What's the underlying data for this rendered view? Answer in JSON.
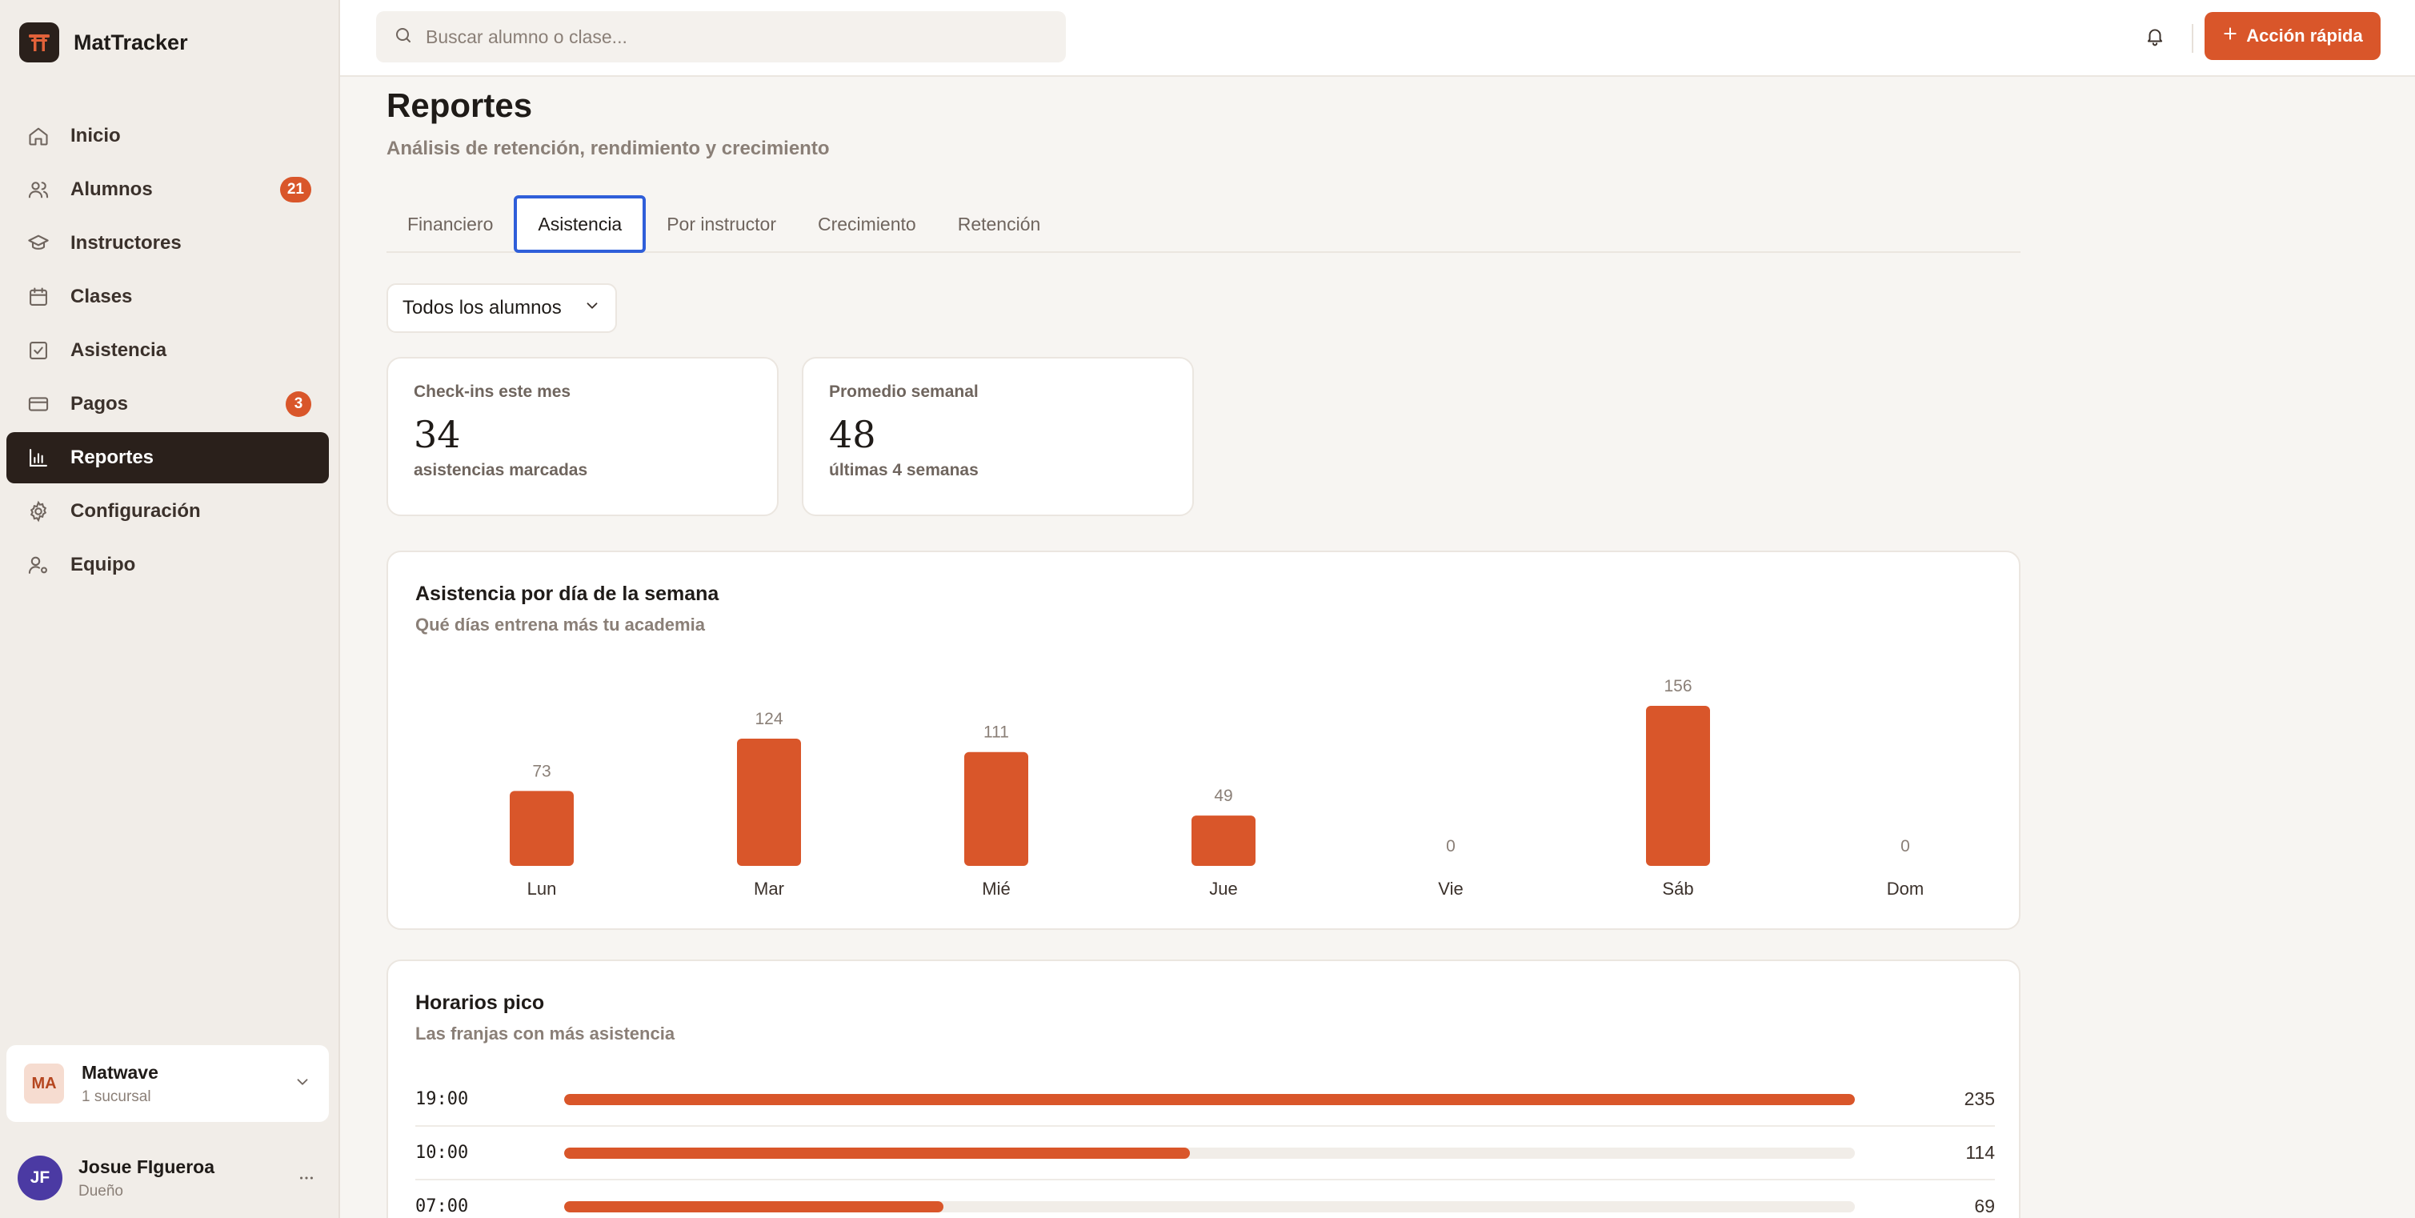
{
  "app": {
    "name": "MatTracker"
  },
  "sidebar": {
    "items": [
      {
        "label": "Inicio",
        "icon": "home-icon"
      },
      {
        "label": "Alumnos",
        "icon": "users-icon",
        "badge": "21"
      },
      {
        "label": "Instructores",
        "icon": "graduation-cap-icon"
      },
      {
        "label": "Clases",
        "icon": "calendar-icon"
      },
      {
        "label": "Asistencia",
        "icon": "check-square-icon"
      },
      {
        "label": "Pagos",
        "icon": "credit-card-icon",
        "badge": "3"
      },
      {
        "label": "Reportes",
        "icon": "bar-chart-icon",
        "active": true
      },
      {
        "label": "Configuración",
        "icon": "gear-icon"
      },
      {
        "label": "Equipo",
        "icon": "user-cog-icon"
      }
    ],
    "workspace": {
      "initials": "MA",
      "name": "Matwave",
      "sub": "1 sucursal"
    },
    "user": {
      "initials": "JF",
      "name": "Josue FIgueroa",
      "role": "Dueño"
    }
  },
  "topbar": {
    "search_placeholder": "Buscar alumno o clase...",
    "quick_action_label": "Acción rápida"
  },
  "page": {
    "title": "Reportes",
    "subtitle": "Análisis de retención, rendimiento y crecimiento",
    "tabs": [
      "Financiero",
      "Asistencia",
      "Por instructor",
      "Crecimiento",
      "Retención"
    ],
    "active_tab": "Asistencia",
    "filter_label": "Todos los alumnos"
  },
  "stats": [
    {
      "label": "Check-ins este mes",
      "value": "34",
      "foot": "asistencias marcadas"
    },
    {
      "label": "Promedio semanal",
      "value": "48",
      "foot": "últimas 4 semanas"
    }
  ],
  "weekday_card": {
    "title": "Asistencia por día de la semana",
    "subtitle": "Qué días entrena más tu academia"
  },
  "peak_card": {
    "title": "Horarios pico",
    "subtitle": "Las franjas con más asistencia",
    "rows": [
      {
        "time": "19:00",
        "value": "235",
        "fraction": 1.0
      },
      {
        "time": "10:00",
        "value": "114",
        "fraction": 0.485
      },
      {
        "time": "07:00",
        "value": "69",
        "fraction": 0.294
      }
    ]
  },
  "colors": {
    "accent": "#d9562a",
    "active_nav": "#2a201b",
    "tab_focus": "#2f5ed9"
  },
  "chart_data": {
    "type": "bar",
    "categories": [
      "Lun",
      "Mar",
      "Mié",
      "Jue",
      "Vie",
      "Sáb",
      "Dom"
    ],
    "values": [
      73,
      124,
      111,
      49,
      0,
      156,
      0
    ],
    "data_labels": [
      "73",
      "124",
      "111",
      "49",
      "0",
      "156",
      "0"
    ],
    "color": "#d9562a",
    "grid": false,
    "legend": "none"
  }
}
